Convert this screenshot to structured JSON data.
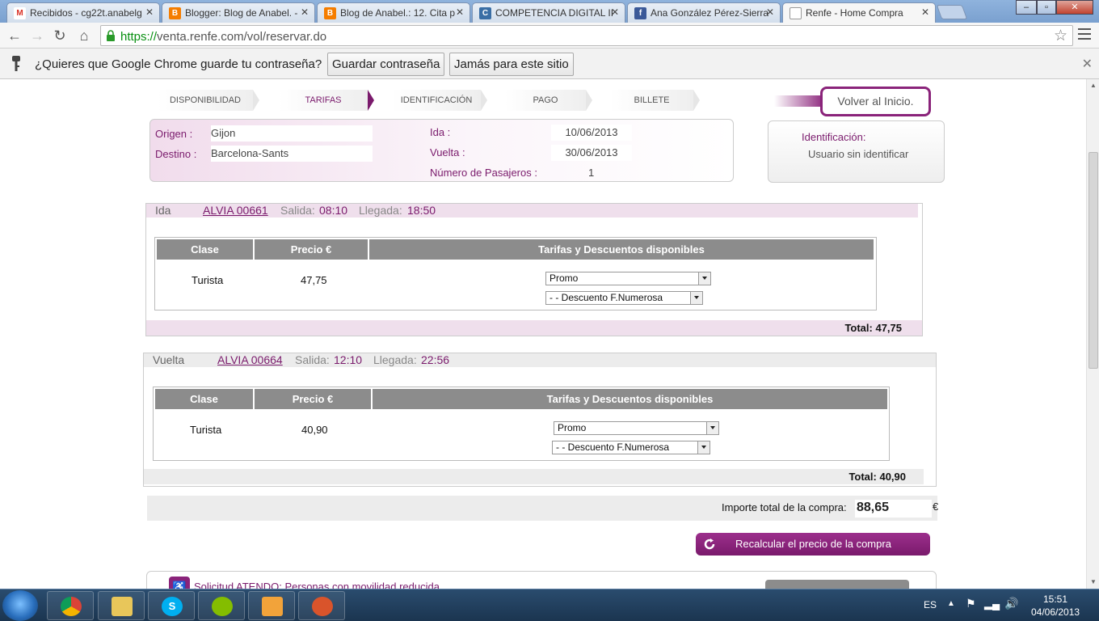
{
  "browser": {
    "tabs": [
      {
        "label": "Recibidos - cg22t.anabelg",
        "icon": "M",
        "icon_color": "#d93025"
      },
      {
        "label": "Blogger: Blog de Anabel. -",
        "icon": "B",
        "icon_color": "#f57d00"
      },
      {
        "label": "Blog de Anabel.: 12. Cita p",
        "icon": "B",
        "icon_color": "#f57d00"
      },
      {
        "label": "COMPETENCIA DIGITAL II",
        "icon": "C",
        "icon_color": "#3a6ea5"
      },
      {
        "label": "Ana González Pérez-Sierra",
        "icon": "f",
        "icon_color": "#3b5998"
      },
      {
        "label": "Renfe - Home Compra",
        "icon": "",
        "icon_color": "#ffffff"
      }
    ],
    "url_scheme": "https://",
    "url_rest": "venta.renfe.com/vol/reservar.do",
    "infobar": {
      "message": "¿Quieres que Google Chrome guarde tu contraseña?",
      "save_label": "Guardar contraseña",
      "never_label": "Jamás para este sitio"
    }
  },
  "steps": [
    "DISPONIBILIDAD",
    "TARIFAS",
    "IDENTIFICACIÓN",
    "PAGO",
    "BILLETE"
  ],
  "volver_label": "Volver al Inicio.",
  "summary": {
    "origen_label": "Origen :",
    "origen": "Gijon",
    "destino_label": "Destino :",
    "destino": "Barcelona-Sants",
    "ida_label": "Ida :",
    "ida": "10/06/2013",
    "vuelta_label": "Vuelta :",
    "vuelta": "30/06/2013",
    "pasajeros_label": "Número de Pasajeros :",
    "pasajeros": "1"
  },
  "identificacion": {
    "label": "Identificación:",
    "value": "Usuario sin identificar"
  },
  "table_headers": [
    "Clase",
    "Precio €",
    "Tarifas y Descuentos disponibles"
  ],
  "legs": [
    {
      "name": "Ida",
      "train": "ALVIA 00661",
      "salida_label": "Salida:",
      "salida": "08:10",
      "llegada_label": "Llegada:",
      "llegada": "18:50",
      "clase": "Turista",
      "precio": "47,75",
      "tarifa": "Promo",
      "descuento": "- - Descuento F.Numerosa",
      "total": "Total: 47,75"
    },
    {
      "name": "Vuelta",
      "train": "ALVIA 00664",
      "salida_label": "Salida:",
      "salida": "12:10",
      "llegada_label": "Llegada:",
      "llegada": "22:56",
      "clase": "Turista",
      "precio": "40,90",
      "tarifa": "Promo",
      "descuento": "- - Descuento F.Numerosa",
      "total": "Total: 40,90"
    }
  ],
  "importe": {
    "label": "Importe total de la compra:",
    "value": "88,65",
    "currency": "€"
  },
  "recalcular_label": "Recalcular el precio de la compra",
  "atendo_label": "Solicitud ATENDO: Personas con movilidad reducida",
  "taskbar": {
    "lang": "ES",
    "time": "15:51",
    "date": "04/06/2013"
  },
  "colors": {
    "accent": "#7a1a6c",
    "header_gray": "#8c8c8c"
  }
}
